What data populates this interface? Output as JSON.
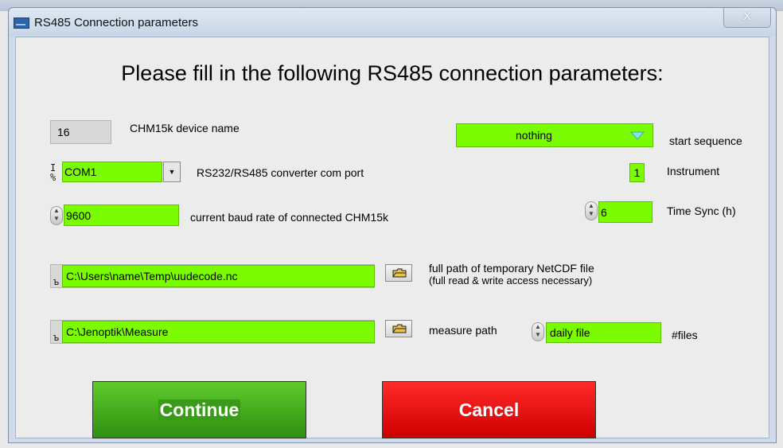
{
  "window": {
    "title": "RS485 Connection parameters",
    "close_glyph": "X"
  },
  "heading": "Please fill in the following RS485 connection parameters:",
  "device_name": {
    "value": "16",
    "label": "CHM15k device name"
  },
  "com_port": {
    "io_glyph": "I/O",
    "value": "COM1",
    "label": "RS232/RS485 converter com port"
  },
  "baud_rate": {
    "value": "9600",
    "label": "current baud rate of connected CHM15k"
  },
  "start_sequence": {
    "value": "nothing",
    "label": "start sequence"
  },
  "instrument": {
    "value": "1",
    "label": "Instrument"
  },
  "time_sync": {
    "value": "6",
    "label": "Time Sync (h)"
  },
  "netcdf_path": {
    "value": "C:\\Users\\name\\Temp\\uudecode.nc",
    "label_line1": "full path of temporary NetCDF file",
    "label_line2": "(full read & write access necessary)"
  },
  "measure_path": {
    "value": "C:\\Jenoptik\\Measure",
    "label": "measure path"
  },
  "files": {
    "value": "daily file",
    "label": "#files"
  },
  "buttons": {
    "continue": "Continue",
    "cancel": "Cancel"
  },
  "icons": {
    "folder": "folder-icon",
    "spinner": "spinner-icon",
    "path": "path-icon",
    "dropdown": "dropdown-arrow-icon"
  },
  "colors": {
    "field_green": "#7cfc00",
    "continue_green": "#3a9b1a",
    "cancel_red": "#e00000"
  }
}
